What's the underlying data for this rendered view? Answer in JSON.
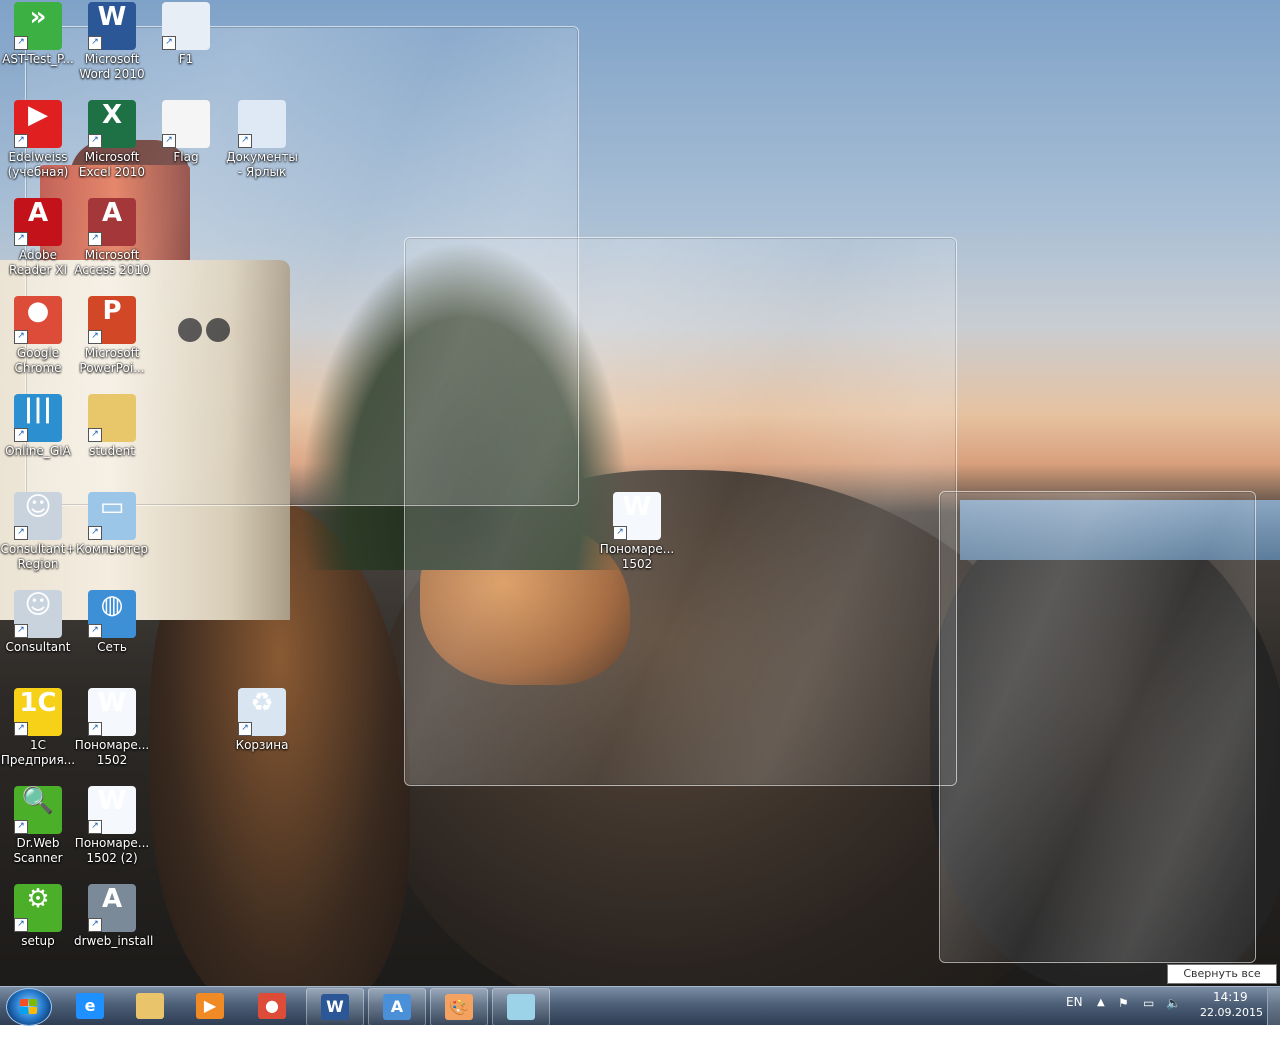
{
  "desktop": {
    "icons": [
      {
        "label": "AST-Test_P...",
        "icon": "ast-test-icon",
        "color": "#3cb043",
        "glyph": "»"
      },
      {
        "label": "Microsoft Word 2010",
        "icon": "word-icon",
        "color": "#2b5797",
        "glyph": "W"
      },
      {
        "label": "F1",
        "icon": "document-icon",
        "color": "#e8eef5",
        "glyph": ""
      },
      {
        "label": "Edelweiss (учебная)",
        "icon": "edelweiss-icon",
        "color": "#e02020",
        "glyph": "▶"
      },
      {
        "label": "Microsoft Excel 2010",
        "icon": "excel-icon",
        "color": "#1e7145",
        "glyph": "X"
      },
      {
        "label": "Flag",
        "icon": "flag-icon",
        "color": "#f5f5f5",
        "glyph": ""
      },
      {
        "label": "Документы - Ярлык",
        "icon": "documents-icon",
        "color": "#dfe9f5",
        "glyph": ""
      },
      {
        "label": "Adobe Reader XI",
        "icon": "adobe-reader-icon",
        "color": "#c4121a",
        "glyph": "A"
      },
      {
        "label": "Microsoft Access 2010",
        "icon": "access-icon",
        "color": "#a4373a",
        "glyph": "A"
      },
      {
        "label": "Google Chrome",
        "icon": "chrome-icon",
        "color": "#dd4b39",
        "glyph": "●"
      },
      {
        "label": "Microsoft PowerPoi...",
        "icon": "powerpoint-icon",
        "color": "#d24726",
        "glyph": "P"
      },
      {
        "label": "Online_GIA",
        "icon": "online-gia-icon",
        "color": "#2b8fd0",
        "glyph": "|||"
      },
      {
        "label": "student",
        "icon": "user-folder-icon",
        "color": "#e8c66a",
        "glyph": ""
      },
      {
        "label": "Consultant+ Region",
        "icon": "consultant-region-icon",
        "color": "#c9d3de",
        "glyph": "☺"
      },
      {
        "label": "Компьютер",
        "icon": "computer-icon",
        "color": "#9cc6e8",
        "glyph": "▭"
      },
      {
        "label": "Пономаре... 1502",
        "icon": "word-document-icon",
        "color": "#f5f8fc",
        "glyph": "W"
      },
      {
        "label": "Consultant",
        "icon": "consultant-icon",
        "color": "#c9d3de",
        "glyph": "☺"
      },
      {
        "label": "Сеть",
        "icon": "network-icon",
        "color": "#3d8fd6",
        "glyph": "◍"
      },
      {
        "label": "1С Предприя...",
        "icon": "1c-icon",
        "color": "#f7d117",
        "glyph": "1С"
      },
      {
        "label": "Пономаре... 1502",
        "icon": "word-document-icon",
        "color": "#f5f8fc",
        "glyph": "W"
      },
      {
        "label": "Корзина",
        "icon": "recycle-bin-icon",
        "color": "#d9e6f2",
        "glyph": "♻"
      },
      {
        "label": "Dr.Web Scanner",
        "icon": "drweb-scanner-icon",
        "color": "#4caf2a",
        "glyph": "🔍"
      },
      {
        "label": "Пономаре... 1502 (2)",
        "icon": "word-document-icon",
        "color": "#f5f8fc",
        "glyph": "W"
      },
      {
        "label": "setup",
        "icon": "setup-icon",
        "color": "#4caf2a",
        "glyph": "⚙"
      },
      {
        "label": "drweb_install",
        "icon": "drweb-install-icon",
        "color": "#7a8a99",
        "glyph": "A"
      }
    ]
  },
  "taskbar": {
    "buttons": [
      {
        "name": "internet-explorer",
        "icon": "internet-explorer-icon",
        "color": "#1e90ff",
        "glyph": "e"
      },
      {
        "name": "windows-explorer",
        "icon": "folder-icon",
        "color": "#e9c46a",
        "glyph": ""
      },
      {
        "name": "media-player",
        "icon": "media-player-icon",
        "color": "#f08a24",
        "glyph": "▶"
      },
      {
        "name": "google-chrome",
        "icon": "chrome-icon",
        "color": "#dd4b39",
        "glyph": "●"
      },
      {
        "name": "microsoft-word",
        "icon": "word-icon",
        "color": "#2b5797",
        "glyph": "W"
      },
      {
        "name": "wordpad",
        "icon": "wordpad-icon",
        "color": "#4a90d9",
        "glyph": "A"
      },
      {
        "name": "paint",
        "icon": "paint-icon",
        "color": "#f4a261",
        "glyph": "🎨"
      },
      {
        "name": "sticky-notes",
        "icon": "notepad-icon",
        "color": "#9cd3e8",
        "glyph": ""
      }
    ],
    "tray": {
      "language": "EN",
      "time": "14:19",
      "date": "22.09.2015"
    },
    "tooltip": "Свернуть все окна"
  }
}
